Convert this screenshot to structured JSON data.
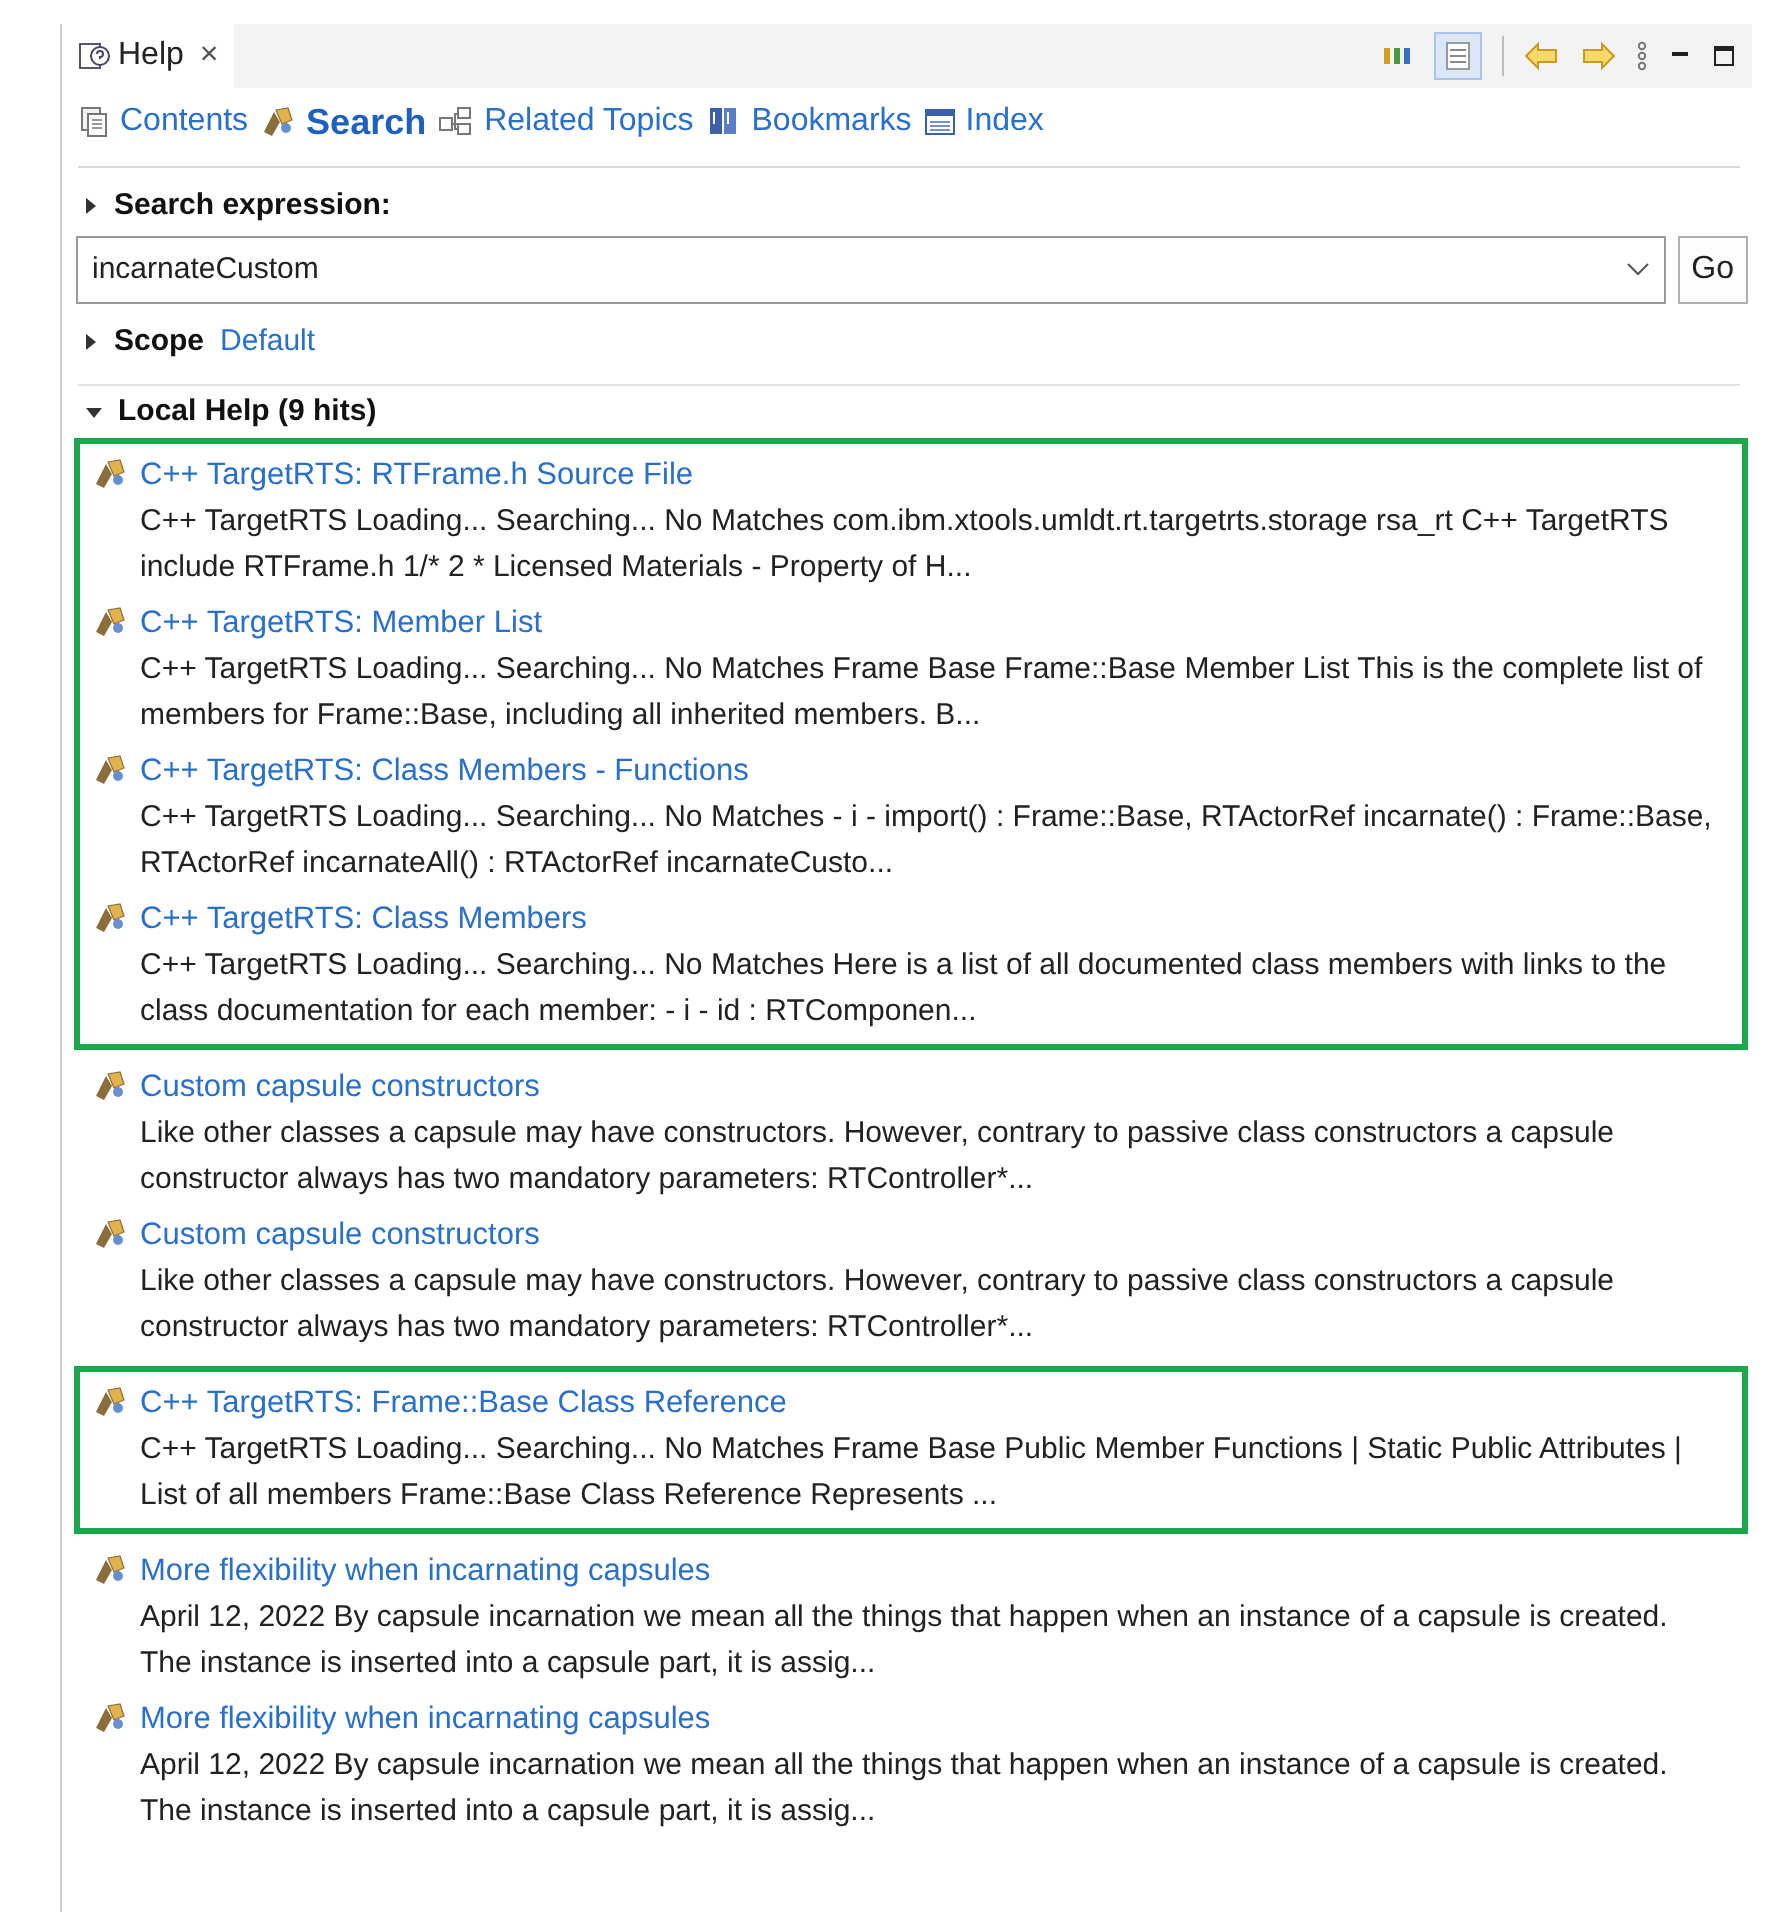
{
  "view_tab": {
    "title": "Help",
    "close": "×",
    "selected": true
  },
  "nav": [
    {
      "label": "Contents",
      "kind": "contents",
      "selected": false
    },
    {
      "label": "Search",
      "kind": "search",
      "selected": true
    },
    {
      "label": "Related Topics",
      "kind": "related",
      "selected": false
    },
    {
      "label": "Bookmarks",
      "kind": "bookmarks",
      "selected": false
    },
    {
      "label": "Index",
      "kind": "index",
      "selected": false
    }
  ],
  "search_expression": {
    "label": "Search expression:",
    "expanded": false,
    "value": "incarnateCustom",
    "button": "Go"
  },
  "scope": {
    "label": "Scope",
    "expanded": false,
    "value": "Default"
  },
  "local_help": {
    "label": "Local Help (9 hits)",
    "expanded": true,
    "groups": [
      {
        "highlighted": true,
        "results": [
          {
            "title": "C++ TargetRTS: RTFrame.h Source File",
            "summary": "C++ TargetRTS Loading... Searching... No Matches com.ibm.xtools.umldt.rt.targetrts.storage rsa_rt C++ TargetRTS include RTFrame.h 1/* 2 * Licensed Materials - Property of H..."
          },
          {
            "title": "C++ TargetRTS: Member List",
            "summary": "C++ TargetRTS Loading... Searching... No Matches Frame Base Frame::Base Member List This is the complete list of members for Frame::Base, including all inherited members. B..."
          },
          {
            "title": "C++ TargetRTS: Class Members - Functions",
            "summary": "C++ TargetRTS Loading... Searching... No Matches - i - import() : Frame::Base, RTActorRef incarnate() : Frame::Base, RTActorRef incarnateAll() : RTActorRef incarnateCusto..."
          },
          {
            "title": "C++ TargetRTS: Class Members",
            "summary": "C++ TargetRTS Loading... Searching... No Matches Here is a list of all documented class members with links to the class documentation for each member: - i - id : RTComponen..."
          }
        ]
      },
      {
        "highlighted": false,
        "results": [
          {
            "title": "Custom capsule constructors",
            "summary": "Like other classes a capsule may have constructors. However, contrary to passive class constructors a capsule constructor always has two mandatory parameters: RTController*..."
          },
          {
            "title": "Custom capsule constructors",
            "summary": "Like other classes a capsule may have constructors. However, contrary to passive class constructors a capsule constructor always has two mandatory parameters: RTController*..."
          }
        ]
      },
      {
        "highlighted": true,
        "results": [
          {
            "title": "C++ TargetRTS: Frame::Base Class Reference",
            "summary": "C++ TargetRTS Loading... Searching... No Matches Frame Base Public Member Functions | Static Public Attributes | List of all members Frame::Base Class Reference Represents ..."
          }
        ]
      },
      {
        "highlighted": false,
        "results": [
          {
            "title": "More flexibility when incarnating capsules",
            "summary": "April 12, 2022 By capsule incarnation we mean all the things that happen when an instance of a capsule is created. The instance is inserted into a capsule part, it is assig..."
          },
          {
            "title": "More flexibility when incarnating capsules",
            "summary": "April 12, 2022 By capsule incarnation we mean all the things that happen when an instance of a capsule is created. The instance is inserted into a capsule part, it is assig..."
          }
        ]
      }
    ]
  }
}
